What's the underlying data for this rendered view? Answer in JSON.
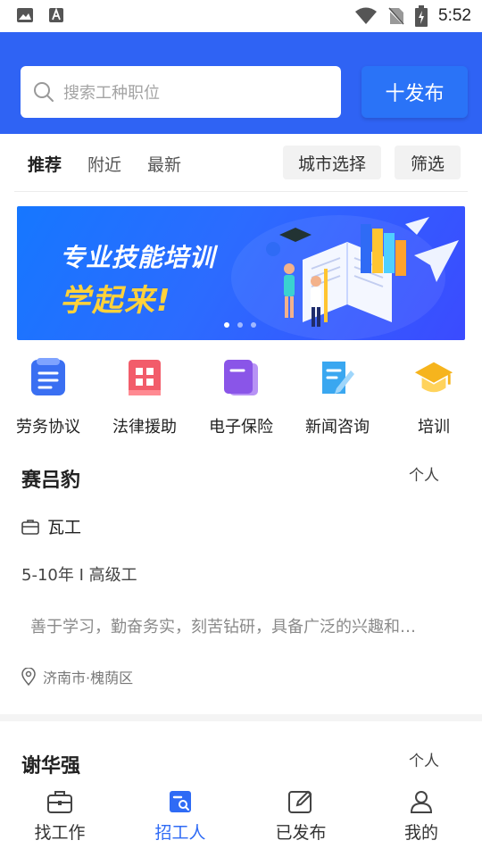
{
  "status": {
    "time": "5:52",
    "icons": [
      "image-icon",
      "a-letter-icon",
      "wifi-icon",
      "no-sim-icon",
      "battery-charging-icon"
    ]
  },
  "header": {
    "search_placeholder": "搜索工种职位",
    "publish_label": "十发布"
  },
  "tabs": [
    {
      "label": "推荐",
      "active": true
    },
    {
      "label": "附近",
      "active": false
    },
    {
      "label": "最新",
      "active": false
    }
  ],
  "filters": {
    "city": "城市选择",
    "filter": "筛选"
  },
  "banner": {
    "line1": "专业技能培训",
    "line2": "学起来!",
    "pages": 3,
    "active_page": 1
  },
  "quick_links": [
    {
      "label": "劳务协议",
      "icon": "document-icon",
      "color": "#3a6ff2"
    },
    {
      "label": "法律援助",
      "icon": "grid-icon",
      "color": "#f25c6a"
    },
    {
      "label": "电子保险",
      "icon": "card-icon",
      "color": "#8a55e8"
    },
    {
      "label": "新闻咨询",
      "icon": "news-edit-icon",
      "color": "#3aa7f0"
    },
    {
      "label": "培训",
      "icon": "graduation-cap-icon",
      "color": "#f6b41d"
    }
  ],
  "cards": [
    {
      "name": "赛吕豹",
      "tag": "个人",
      "job": "瓦工",
      "experience": "5-10年 I 高级工",
      "description": "善于学习，勤奋务实，刻苦钻研，具备广泛的兴趣和…",
      "location": "济南市·槐荫区"
    },
    {
      "name": "谢华强",
      "tag": "个人"
    }
  ],
  "bottom_nav": [
    {
      "label": "找工作",
      "icon": "briefcase-icon",
      "active": false
    },
    {
      "label": "招工人",
      "icon": "recruit-search-icon",
      "active": true
    },
    {
      "label": "已发布",
      "icon": "published-edit-icon",
      "active": false
    },
    {
      "label": "我的",
      "icon": "profile-icon",
      "active": false
    }
  ],
  "colors": {
    "primary": "#2f63f4",
    "accent_button": "#2a73f7",
    "active_nav": "#2f6bf5",
    "banner_highlight": "#ffd23a"
  }
}
